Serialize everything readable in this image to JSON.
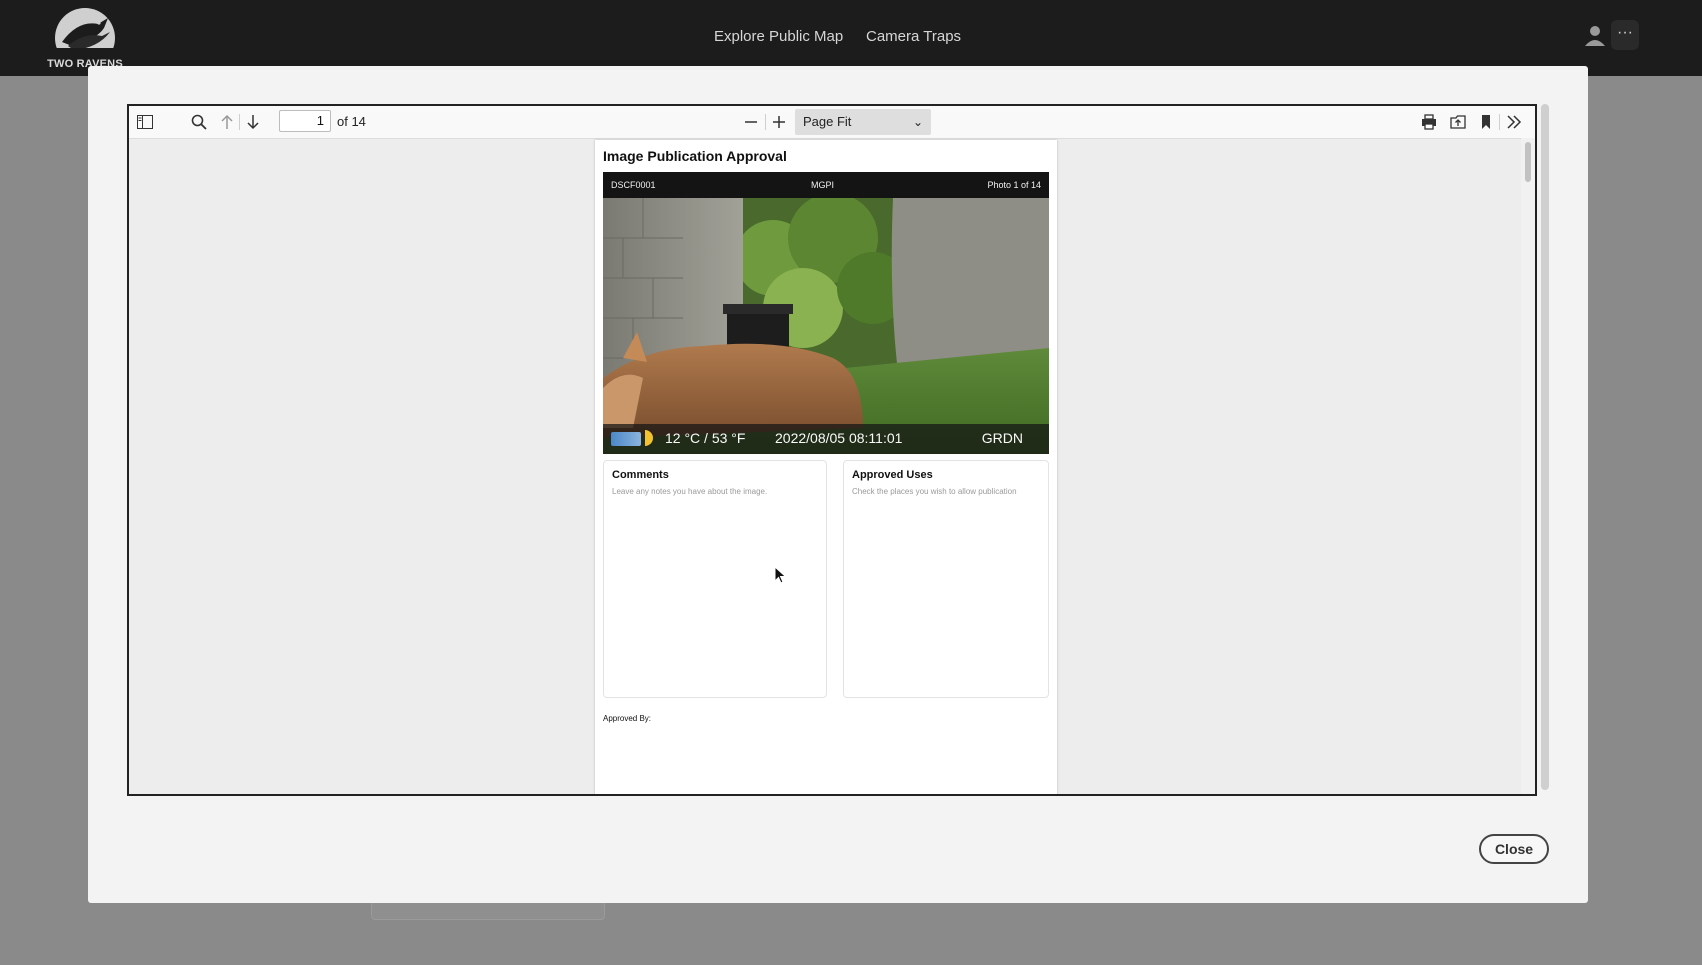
{
  "app": {
    "logo_text": "TWO RAVENS",
    "nav": [
      "Explore Public Map",
      "Camera Traps"
    ],
    "more_label": "···"
  },
  "viewer": {
    "page_number": "1",
    "page_of": "of 14",
    "zoom": "Page Fit"
  },
  "document": {
    "title": "Image Publication Approval",
    "photo_header": {
      "left": "DSCF0001",
      "center": "MGPI",
      "right": "Photo 1 of 14"
    },
    "photo_overlay": {
      "temperature": "12 °C / 53 °F",
      "datetime": "2022/08/05 08:11:01",
      "location": "GRDN"
    },
    "comments": {
      "title": "Comments",
      "hint": "Leave any notes you have about the image."
    },
    "approved_uses": {
      "title": "Approved Uses",
      "hint": "Check the places you wish to allow publication"
    },
    "approved_by": "Approved By:"
  },
  "modal": {
    "close_label": "Close"
  },
  "colors": {
    "appbar": "#1c1c1c",
    "overlay": "#8a8a8a",
    "modal": "#f3f3f3"
  }
}
